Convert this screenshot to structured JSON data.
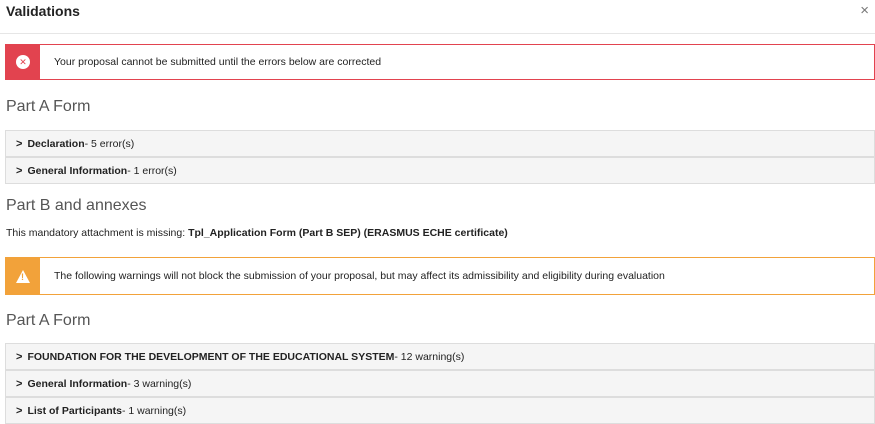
{
  "dialog": {
    "title": "Validations",
    "close_glyph": "×"
  },
  "error_alert": {
    "icon": "error-circle-icon",
    "color": "#e2434f",
    "message": "Your proposal cannot be submitted until the errors below are corrected"
  },
  "errors": {
    "part_a": {
      "title": "Part A Form",
      "items": [
        {
          "name": "Declaration",
          "count": " - 5 error(s)"
        },
        {
          "name": "General Information",
          "count": " - 1 error(s)"
        }
      ]
    },
    "part_b": {
      "title": "Part B and annexes",
      "missing_prefix": "This mandatory attachment is missing: ",
      "missing_name": "Tpl_Application Form (Part B SEP) (ERASMUS ECHE certificate)"
    }
  },
  "warning_alert": {
    "icon": "warning-triangle-icon",
    "color": "#f2a23a",
    "message": "The following warnings will not block the submission of your proposal, but may affect its admissibility and eligibility during evaluation"
  },
  "warnings": {
    "part_a": {
      "title": "Part A Form",
      "items": [
        {
          "name": "FOUNDATION FOR THE DEVELOPMENT OF THE EDUCATIONAL SYSTEM",
          "count": " - 12 warning(s)"
        },
        {
          "name": "General Information",
          "count": " - 3 warning(s)"
        },
        {
          "name": "List of Participants",
          "count": " - 1 warning(s)"
        }
      ]
    }
  },
  "chevron_glyph": ">"
}
